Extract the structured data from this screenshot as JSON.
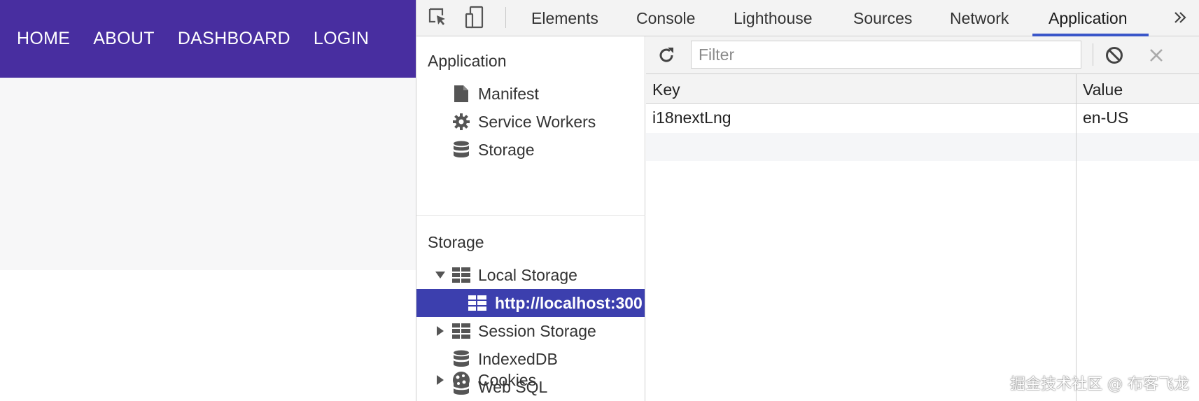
{
  "app": {
    "nav": [
      "HOME",
      "ABOUT",
      "DASHBOARD",
      "LOGIN"
    ],
    "brand_color": "#482ea0"
  },
  "devtools": {
    "tabs": [
      "Elements",
      "Console",
      "Lighthouse",
      "Sources",
      "Network",
      "Application"
    ],
    "active_tab": "Application",
    "more_icon": "double-chevron-right-icon",
    "accent_color": "#3a56c9",
    "sidebar": {
      "application_title": "Application",
      "application_items": [
        {
          "label": "Manifest",
          "icon": "file-icon"
        },
        {
          "label": "Service Workers",
          "icon": "gear-icon"
        },
        {
          "label": "Storage",
          "icon": "database-icon"
        }
      ],
      "storage_title": "Storage",
      "storage_items": [
        {
          "label": "Local Storage",
          "icon": "grid-icon",
          "expanded": true
        },
        {
          "label": "http://localhost:300",
          "icon": "grid-icon",
          "selected": true
        },
        {
          "label": "Session Storage",
          "icon": "grid-icon",
          "expanded": false
        },
        {
          "label": "IndexedDB",
          "icon": "database-icon"
        },
        {
          "label": "Web SQL",
          "icon": "database-icon"
        },
        {
          "label": "Cookies",
          "icon": "cookie-icon",
          "expanded": false
        }
      ]
    },
    "toolbar": {
      "filter_placeholder": "Filter",
      "filter_value": ""
    },
    "table": {
      "headers": [
        "Key",
        "Value"
      ],
      "rows": [
        [
          "i18nextLng",
          "en-US"
        ]
      ]
    }
  },
  "watermark": "掘金技术社区 @ 布客飞龙"
}
